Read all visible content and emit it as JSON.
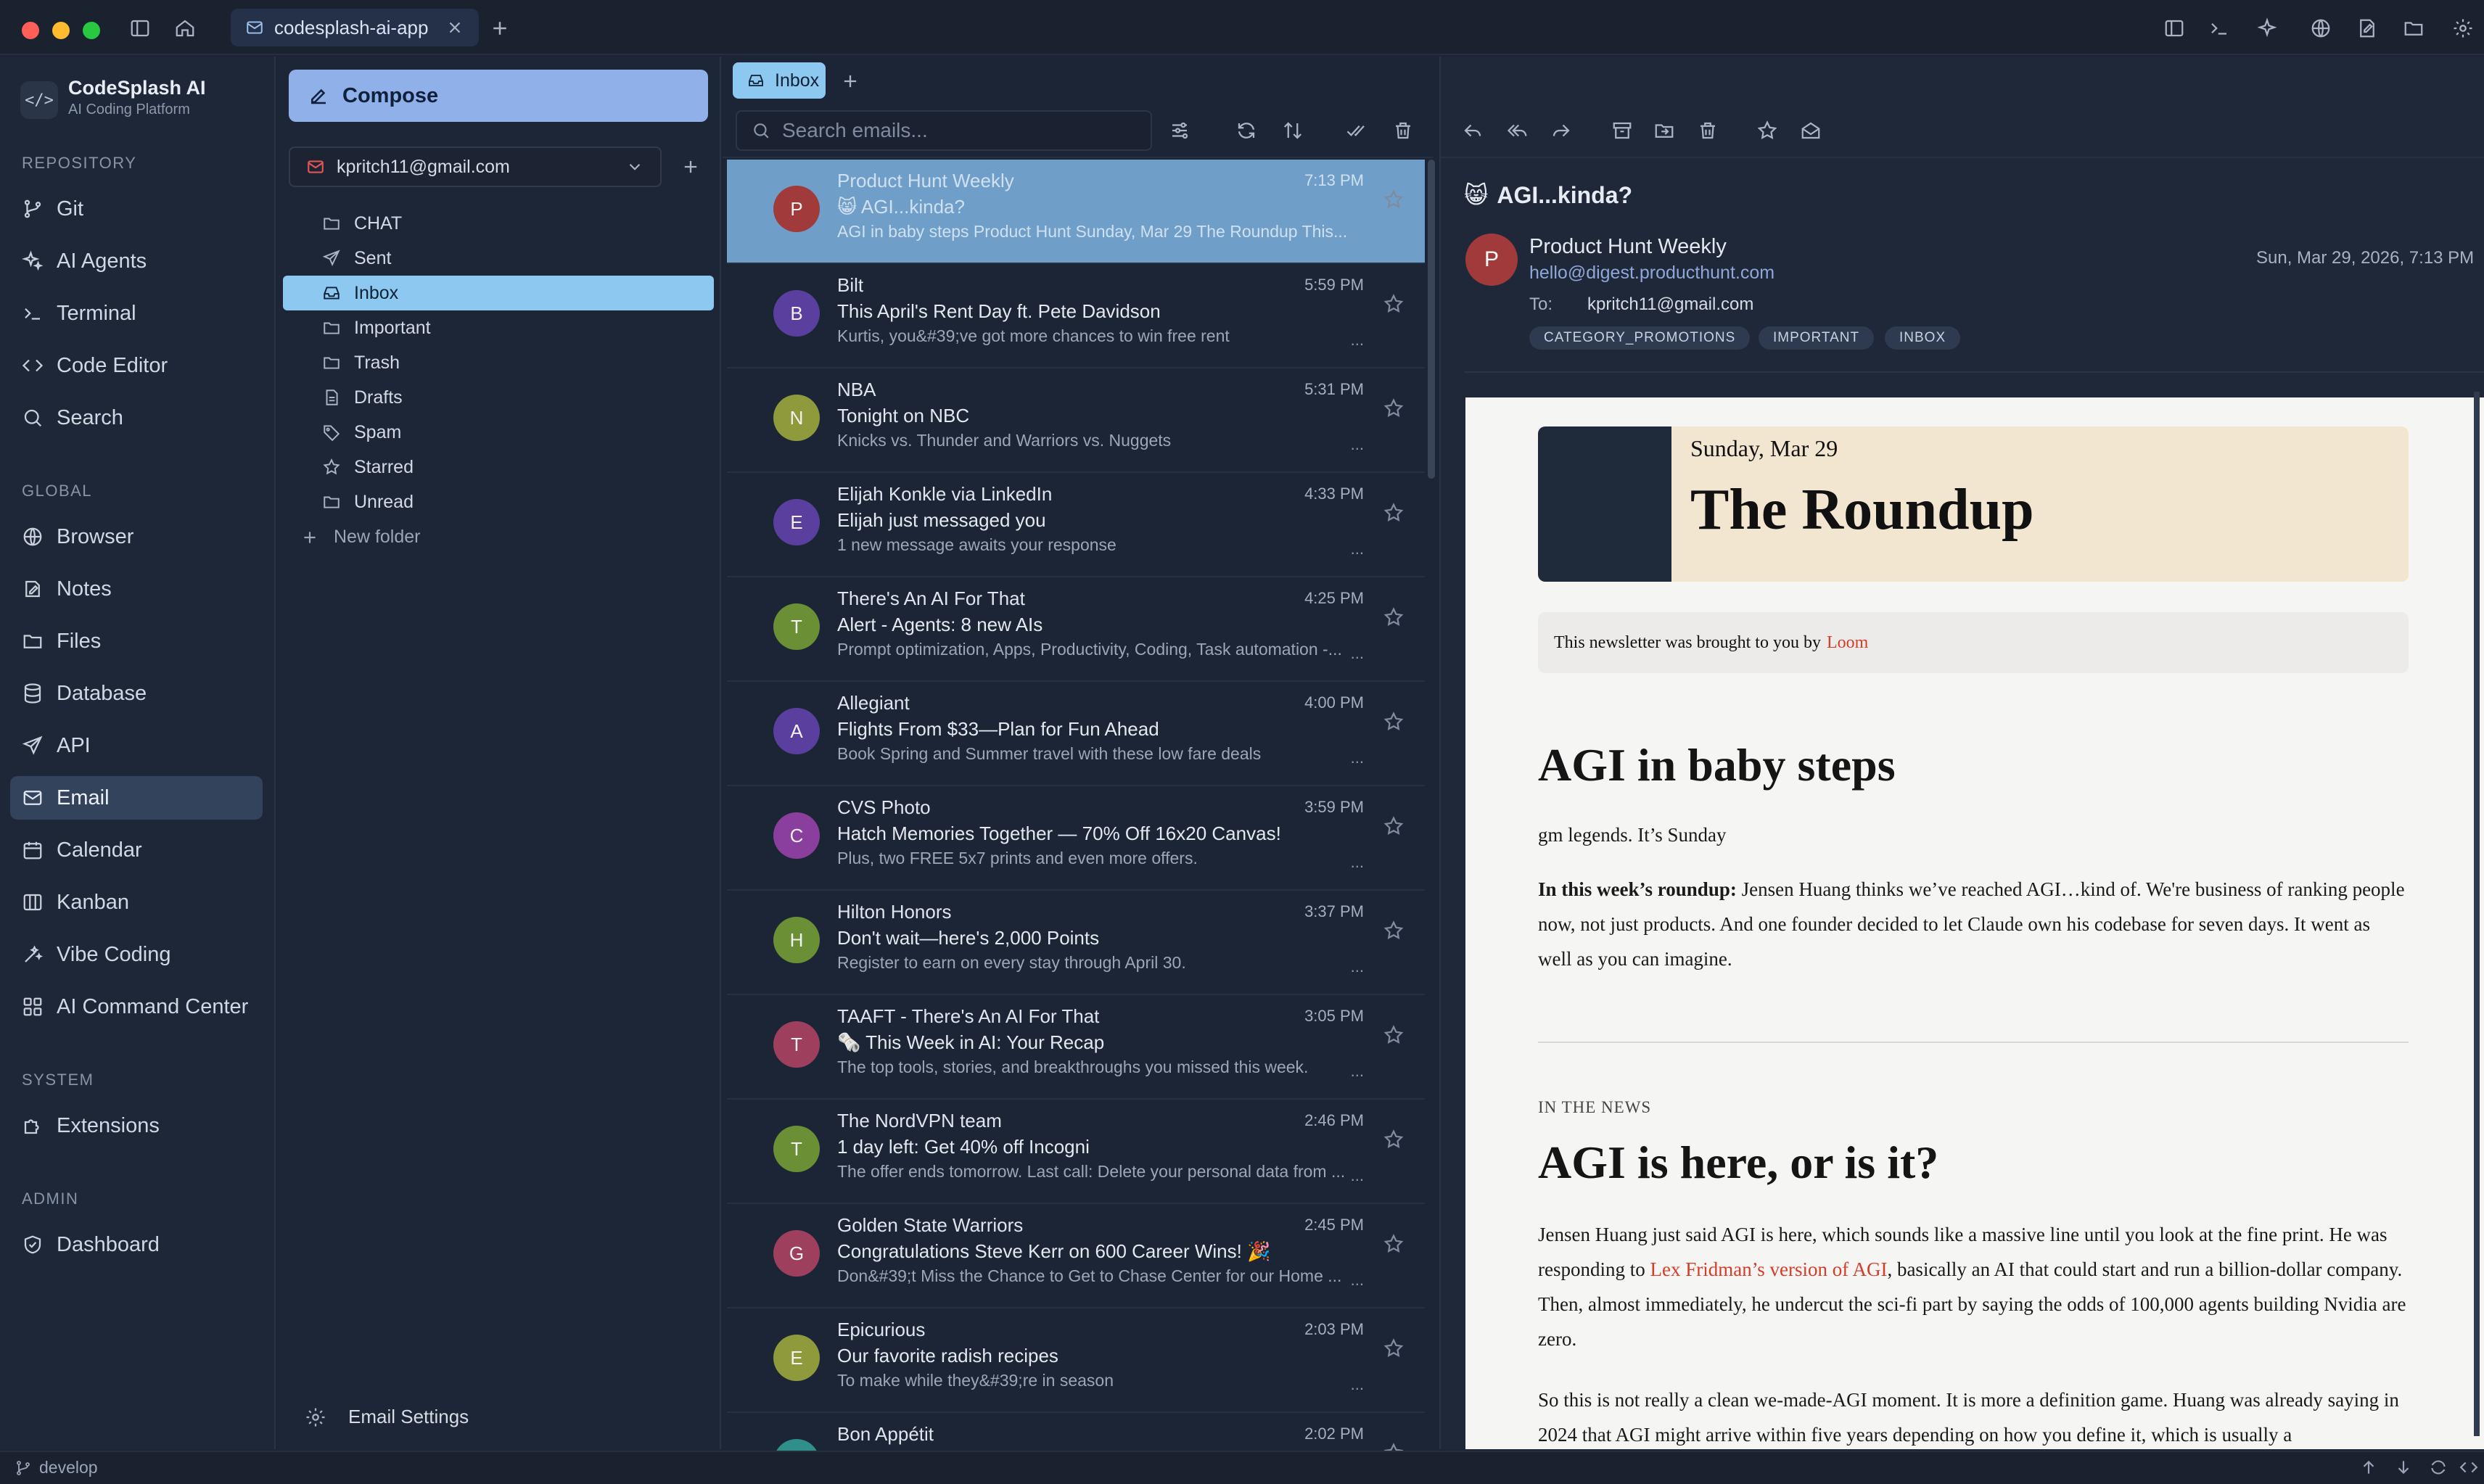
{
  "titlebar": {
    "tab_label": "codesplash-ai-app"
  },
  "brand": {
    "name": "CodeSplash AI",
    "subtitle": "AI Coding Platform",
    "logo_text": "</>"
  },
  "sidebar": {
    "sections": {
      "repository": "REPOSITORY",
      "global": "GLOBAL",
      "system": "SYSTEM",
      "admin": "ADMIN"
    },
    "items": {
      "git": "Git",
      "ai_agents": "AI Agents",
      "terminal": "Terminal",
      "code_editor": "Code Editor",
      "search": "Search",
      "browser": "Browser",
      "notes": "Notes",
      "files": "Files",
      "database": "Database",
      "api": "API",
      "email": "Email",
      "calendar": "Calendar",
      "kanban": "Kanban",
      "vibe_coding": "Vibe Coding",
      "ai_command_center": "AI Command Center",
      "extensions": "Extensions",
      "dashboard": "Dashboard"
    },
    "active": "Email"
  },
  "mailnav": {
    "compose_label": "Compose",
    "account_email": "kpritch11@gmail.com",
    "folders": [
      "CHAT",
      "Sent",
      "Inbox",
      "Important",
      "Trash",
      "Drafts",
      "Spam",
      "Starred",
      "Unread"
    ],
    "active_folder": "Inbox",
    "new_folder_label": "New folder",
    "settings_label": "Email Settings"
  },
  "list": {
    "tab_label": "Inbox",
    "search_placeholder": "Search emails...",
    "messages": [
      {
        "initial": "P",
        "color": "#a13b3b",
        "sender": "Product Hunt Weekly",
        "subject": "😸 AGI...kinda?",
        "snippet": "AGI in baby steps Product Hunt Sunday, Mar 29 The Roundup This...",
        "time": "7:13 PM"
      },
      {
        "initial": "B",
        "color": "#5a3f9e",
        "sender": "Bilt",
        "subject": "This April's Rent Day ft. Pete Davidson",
        "snippet": "Kurtis, you&#39;ve got more chances to win free rent",
        "time": "5:59 PM"
      },
      {
        "initial": "N",
        "color": "#8f9a3c",
        "sender": "NBA",
        "subject": "Tonight on NBC",
        "snippet": "Knicks vs. Thunder and Warriors vs. Nuggets",
        "time": "5:31 PM"
      },
      {
        "initial": "E",
        "color": "#5a3f9e",
        "sender": "Elijah Konkle via LinkedIn",
        "subject": "Elijah just messaged you",
        "snippet": "1 new message awaits your response",
        "time": "4:33 PM"
      },
      {
        "initial": "T",
        "color": "#6b8f34",
        "sender": "There's An AI For That",
        "subject": "Alert - Agents: 8 new AIs",
        "snippet": "Prompt optimization, Apps, Productivity, Coding, Task automation -...",
        "time": "4:25 PM"
      },
      {
        "initial": "A",
        "color": "#5a3f9e",
        "sender": "Allegiant",
        "subject": "Flights From $33—Plan for Fun Ahead",
        "snippet": "Book Spring and Summer travel with these low fare deals",
        "time": "4:00 PM"
      },
      {
        "initial": "C",
        "color": "#8a3f9e",
        "sender": "CVS Photo",
        "subject": "Hatch Memories Together — 70% Off 16x20 Canvas!",
        "snippet": "Plus, two FREE 5x7 prints and even more offers.",
        "time": "3:59 PM"
      },
      {
        "initial": "H",
        "color": "#6b8f34",
        "sender": "Hilton Honors",
        "subject": "Don't wait—here's 2,000 Points",
        "snippet": "Register to earn on every stay through April 30.",
        "time": "3:37 PM"
      },
      {
        "initial": "T",
        "color": "#9e3f5e",
        "sender": "TAAFT - There's An AI For That",
        "subject": "🗞️ This Week in AI: Your Recap",
        "snippet": "The top tools, stories, and breakthroughs you missed this week.",
        "time": "3:05 PM"
      },
      {
        "initial": "T",
        "color": "#6b8f34",
        "sender": "The NordVPN team",
        "subject": "1 day left: Get 40% off Incogni",
        "snippet": "The offer ends tomorrow. Last call: Delete your personal data from ...",
        "time": "2:46 PM"
      },
      {
        "initial": "G",
        "color": "#9e3f5e",
        "sender": "Golden State Warriors",
        "subject": "Congratulations Steve Kerr on 600 Career Wins! 🎉",
        "snippet": "Don&#39;t Miss the Chance to Get to Chase Center for our Home ...",
        "time": "2:45 PM"
      },
      {
        "initial": "E",
        "color": "#8f9a3c",
        "sender": "Epicurious",
        "subject": "Our favorite radish recipes",
        "snippet": "To make while they&#39;re in season",
        "time": "2:03 PM"
      },
      {
        "initial": "B",
        "color": "#2f8f8a",
        "sender": "Bon Appétit",
        "subject": "",
        "snippet": "",
        "time": "2:02 PM"
      }
    ]
  },
  "reader": {
    "subject_emoji": "😸",
    "subject": "AGI...kinda?",
    "sender_initial": "P",
    "sender_name": "Product Hunt Weekly",
    "sender_email": "hello@digest.producthunt.com",
    "to_label": "To:",
    "to_value": "kpritch11@gmail.com",
    "date": "Sun, Mar 29, 2026, 7:13 PM",
    "labels": [
      "CATEGORY_PROMOTIONS",
      "IMPORTANT",
      "INBOX"
    ]
  },
  "newsletter": {
    "date": "Sunday, Mar 29",
    "name": "The Roundup",
    "sponsor_text": "This newsletter was brought to you by",
    "sponsor_link": "Loom",
    "h1": "AGI in baby steps",
    "greeting": "gm legends. It’s Sunday",
    "p1_bold": "In this week’s roundup:",
    "p1_rest": " Jensen Huang thinks we’ve reached AGI…kind of. We're business of ranking people now, not just products. And one founder decided to let Claude own his codebase for seven days. It went as well as you can imagine.",
    "kicker": "IN THE NEWS",
    "h2": "AGI is here, or is it?",
    "p2_a": "Jensen Huang just said AGI is here, which sounds like a massive line until you look at the fine print. He was responding to ",
    "p2_link": "Lex Fridman’s version of AGI",
    "p2_b": ", basically an AI that could start and run a billion-dollar company. Then, almost immediately, he undercut the sci-fi part by saying the odds of 100,000 agents building Nvidia are zero.",
    "p3": "So this is not really a clean we-made-AGI moment. It is more a definition game. Huang was already saying in 2024 that AGI might arrive within five years depending on how you define it, which is usually a"
  },
  "statusbar": {
    "branch": "develop"
  }
}
